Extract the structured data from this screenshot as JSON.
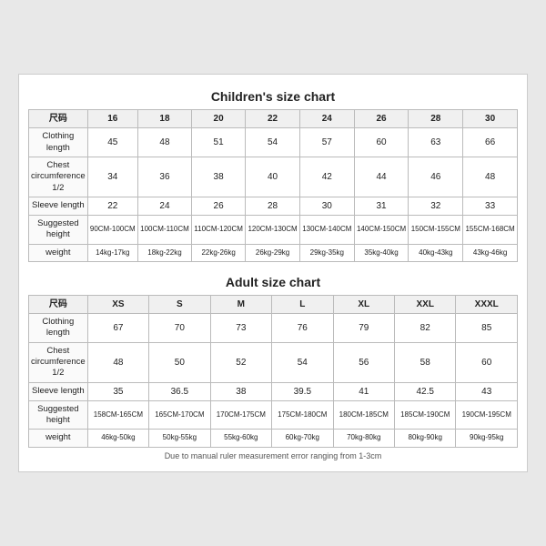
{
  "children_chart": {
    "title": "Children's size chart",
    "columns": [
      "尺码",
      "16",
      "18",
      "20",
      "22",
      "24",
      "26",
      "28",
      "30"
    ],
    "rows": [
      {
        "label": "Clothing length",
        "values": [
          "45",
          "48",
          "51",
          "54",
          "57",
          "60",
          "63",
          "66"
        ]
      },
      {
        "label": "Chest circumference 1/2",
        "values": [
          "34",
          "36",
          "38",
          "40",
          "42",
          "44",
          "46",
          "48"
        ]
      },
      {
        "label": "Sleeve length",
        "values": [
          "22",
          "24",
          "26",
          "28",
          "30",
          "31",
          "32",
          "33"
        ]
      },
      {
        "label": "Suggested height",
        "values": [
          "90CM-100CM",
          "100CM-110CM",
          "110CM-120CM",
          "120CM-130CM",
          "130CM-140CM",
          "140CM-150CM",
          "150CM-155CM",
          "155CM-168CM"
        ]
      },
      {
        "label": "weight",
        "values": [
          "14kg-17kg",
          "18kg-22kg",
          "22kg-26kg",
          "26kg-29kg",
          "29kg-35kg",
          "35kg-40kg",
          "40kg-43kg",
          "43kg-46kg"
        ]
      }
    ]
  },
  "adult_chart": {
    "title": "Adult size chart",
    "columns": [
      "尺码",
      "XS",
      "S",
      "M",
      "L",
      "XL",
      "XXL",
      "XXXL"
    ],
    "rows": [
      {
        "label": "Clothing length",
        "values": [
          "67",
          "70",
          "73",
          "76",
          "79",
          "82",
          "85"
        ]
      },
      {
        "label": "Chest circumference 1/2",
        "values": [
          "48",
          "50",
          "52",
          "54",
          "56",
          "58",
          "60"
        ]
      },
      {
        "label": "Sleeve length",
        "values": [
          "35",
          "36.5",
          "38",
          "39.5",
          "41",
          "42.5",
          "43"
        ]
      },
      {
        "label": "Suggested height",
        "values": [
          "158CM-165CM",
          "165CM-170CM",
          "170CM-175CM",
          "175CM-180CM",
          "180CM-185CM",
          "185CM-190CM",
          "190CM-195CM"
        ]
      },
      {
        "label": "weight",
        "values": [
          "46kg-50kg",
          "50kg-55kg",
          "55kg-60kg",
          "60kg-70kg",
          "70kg-80kg",
          "80kg-90kg",
          "90kg-95kg"
        ]
      }
    ]
  },
  "footnote": "Due to manual ruler measurement error ranging from 1-3cm"
}
